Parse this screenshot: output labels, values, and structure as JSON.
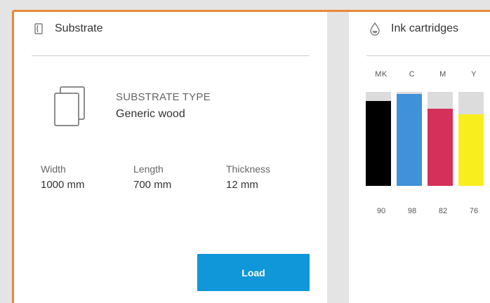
{
  "substrate_panel": {
    "title": "Substrate",
    "type_label": "SUBSTRATE TYPE",
    "type_value": "Generic wood",
    "dimensions": [
      {
        "label": "Width",
        "value": "1000 mm"
      },
      {
        "label": "Length",
        "value": "700 mm"
      },
      {
        "label": "Thickness",
        "value": "12 mm"
      }
    ],
    "load_label": "Load"
  },
  "ink_panel": {
    "title": "Ink cartridges",
    "cartridges": [
      {
        "name": "MK",
        "level": "90",
        "level_fraction": 0.9,
        "color": "#000000"
      },
      {
        "name": "C",
        "level": "98",
        "level_fraction": 0.98,
        "color": "#3f91d8"
      },
      {
        "name": "M",
        "level": "82",
        "level_fraction": 0.82,
        "color": "#d4305a"
      },
      {
        "name": "Y",
        "level": "76",
        "level_fraction": 0.76,
        "color": "#f9ee1d"
      }
    ]
  },
  "colors": {
    "accent": "#0f97d9",
    "highlight_frame": "#e8883a"
  },
  "icons": {
    "substrate_header": "substrate-icon",
    "ink_header": "ink-drop-icon",
    "substrate_type": "substrate-sheets-icon"
  }
}
